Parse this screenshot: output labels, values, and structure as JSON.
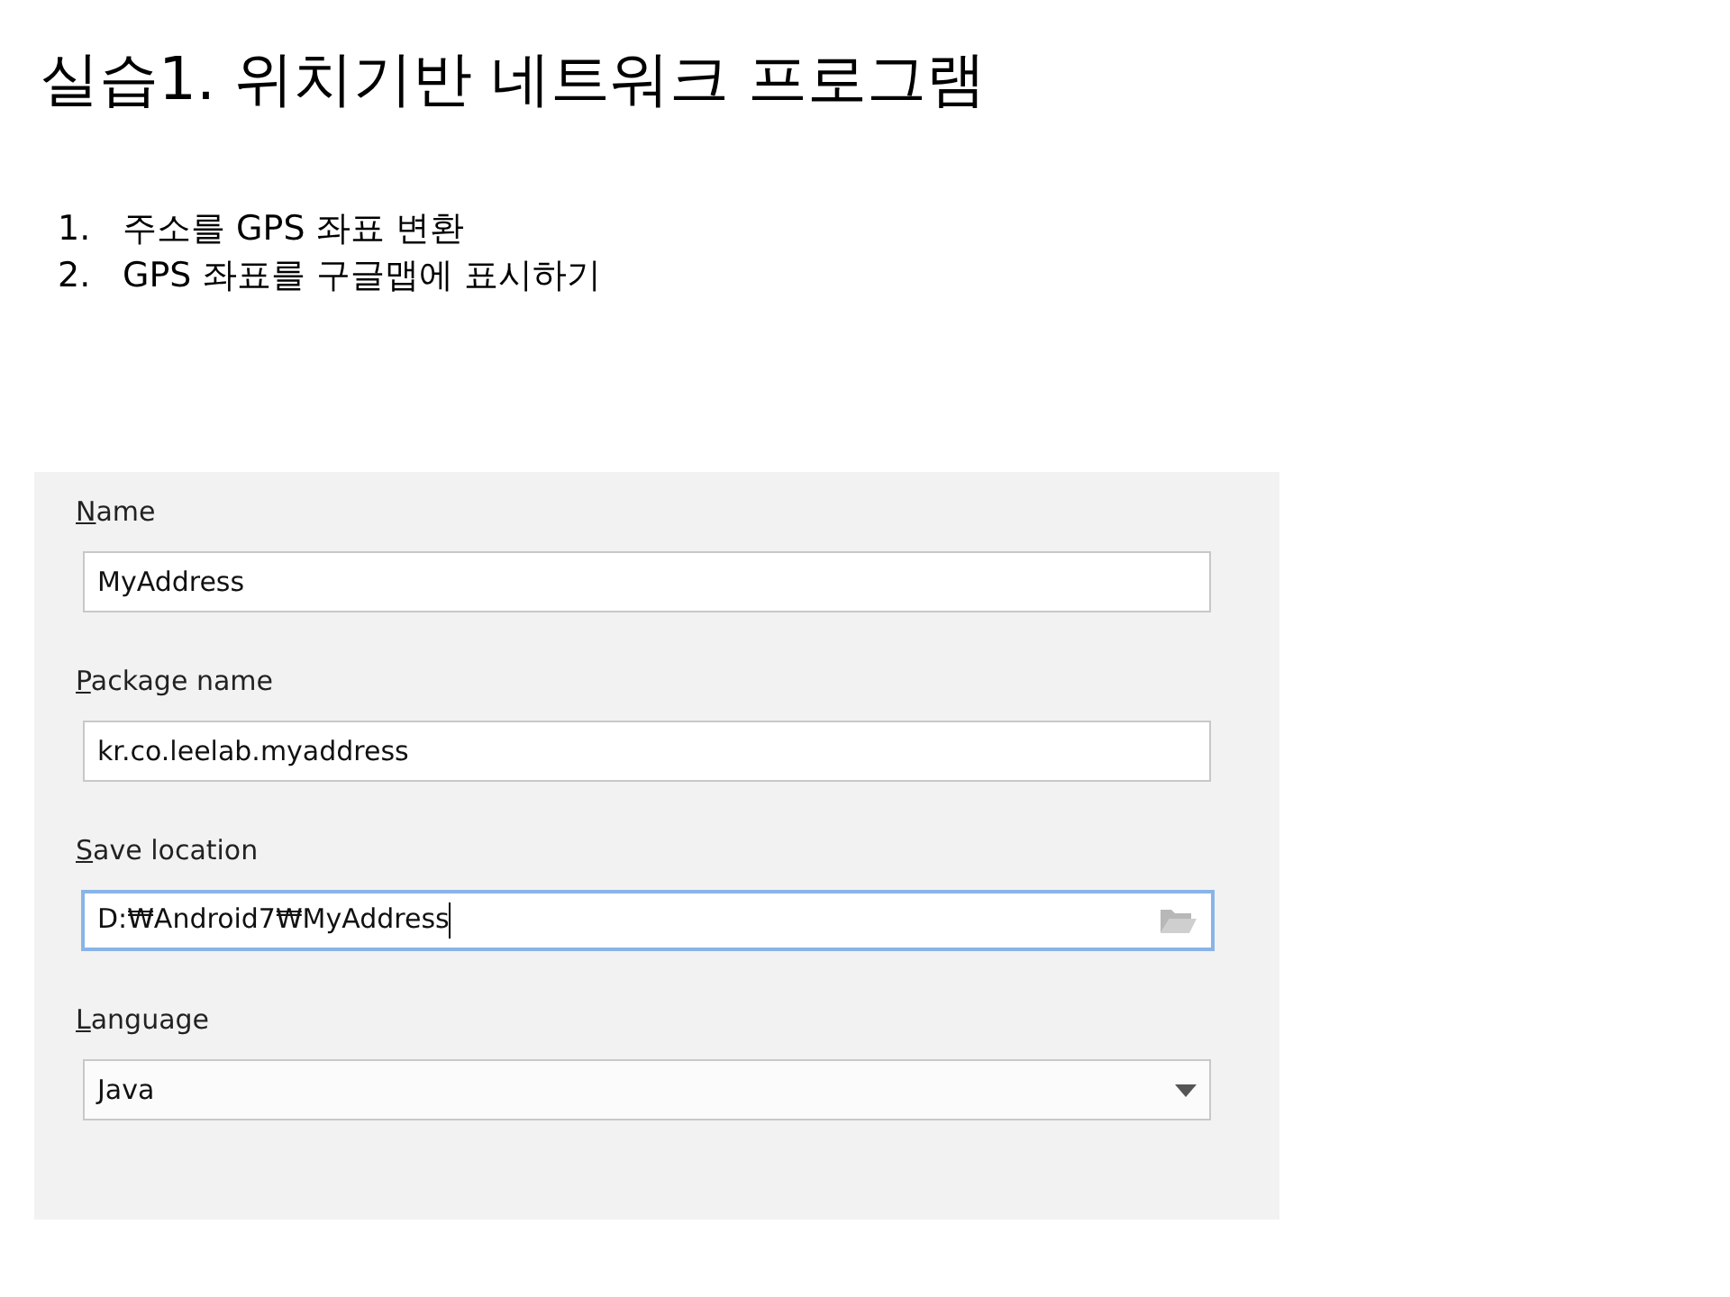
{
  "slide": {
    "title": "실습1. 위치기반 네트워크 프로그램",
    "steps": [
      {
        "number": "1.",
        "text": "주소를 GPS 좌표 변환"
      },
      {
        "number": "2.",
        "text": "GPS 좌표를 구글맵에 표시하기"
      }
    ]
  },
  "dialog": {
    "fields": [
      {
        "label": "Name",
        "kind": "text",
        "value": "MyAddress",
        "focused": false
      },
      {
        "label": "Package name",
        "kind": "text",
        "value": "kr.co.leelab.myaddress",
        "focused": false
      },
      {
        "label": "Save location",
        "kind": "path",
        "value": "D:₩Android7₩MyAddress",
        "focused": true
      },
      {
        "label": "Language",
        "kind": "dropdown",
        "value": "Java",
        "focused": false
      }
    ]
  }
}
